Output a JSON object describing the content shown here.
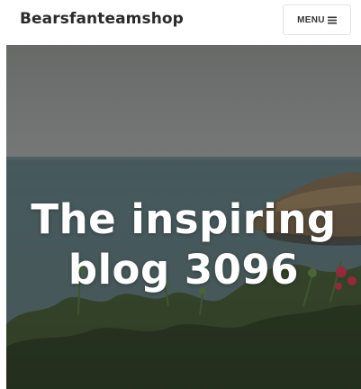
{
  "header": {
    "site_title": "Bearsfanteamshop",
    "menu_label": "MENU"
  },
  "hero": {
    "title": "The inspiring blog 3096"
  },
  "icons": {
    "menu": "hamburger-icon"
  }
}
